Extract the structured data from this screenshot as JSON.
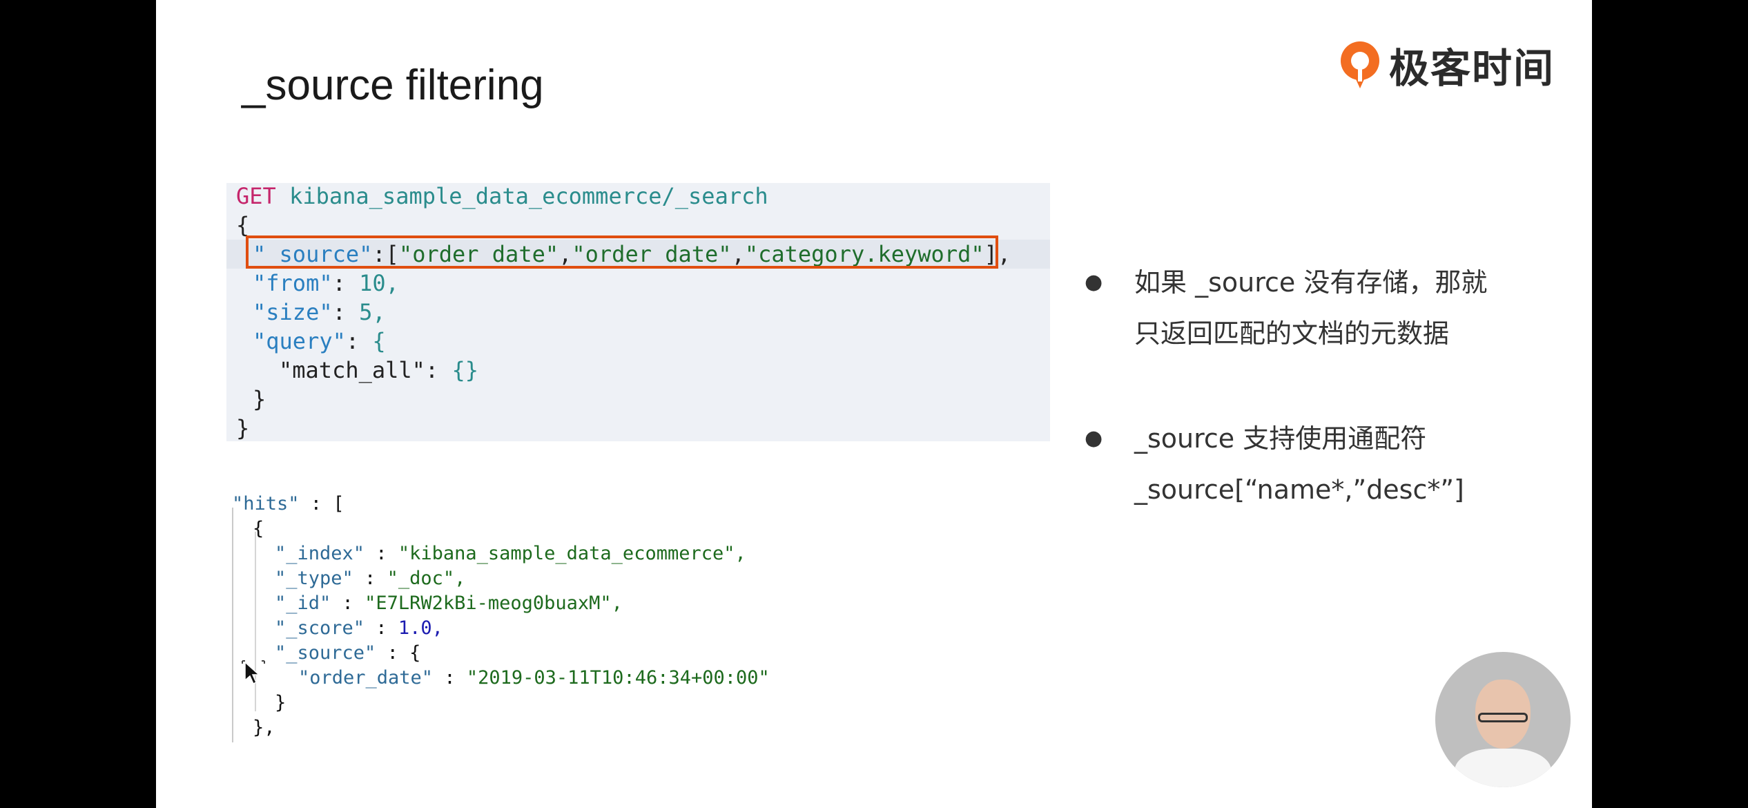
{
  "slide": {
    "title": "_source filtering",
    "logo_text": "极客时间"
  },
  "request_code": {
    "method": "GET",
    "path": "kibana_sample_data_ecommerce/_search",
    "open_brace": "{",
    "source_key": "\"_source\"",
    "source_colon": ":[",
    "source_v1": "\"order_date\"",
    "source_comma1": ",",
    "source_v2": "\"order_date\"",
    "source_comma2": ",",
    "source_v3": "\"category.keyword\"",
    "source_close": "],",
    "from_key": "\"from\"",
    "from_sep": ": ",
    "from_val": "10,",
    "size_key": "\"size\"",
    "size_sep": ": ",
    "size_val": "5,",
    "query_key": "\"query\"",
    "query_sep": ": ",
    "query_open": "{",
    "match_all": "\"match_all\": ",
    "match_all_val": "{}",
    "query_close": "}",
    "close_brace": "}"
  },
  "response_code": {
    "hits_key": "\"hits\"",
    "hits_rest": " : [",
    "obj_open": "{",
    "index_key": "\"_index\"",
    "index_val": "\"kibana_sample_data_ecommerce\",",
    "type_key": "\"_type\"",
    "type_val": "\"_doc\",",
    "id_key": "\"_id\"",
    "id_val": "\"E7LRW2kBi-meog0buaxM\",",
    "score_key": "\"_score\"",
    "score_val": "1.0,",
    "source_key": "\"_source\"",
    "source_open": " : {",
    "order_date_key": "\"order_date\"",
    "order_date_val": "\"2019-03-11T10:46:34+00:00\"",
    "source_close": "}",
    "obj_close": "},",
    "sep": " : "
  },
  "bullets": [
    {
      "marker": "●",
      "line1": "如果 _source 没有存储，那就",
      "line2": "只返回匹配的文档的元数据"
    },
    {
      "marker": "●",
      "line1": "_source 支持使用通配符",
      "line2": "_source[“name*,”desc*”]"
    }
  ],
  "colors": {
    "highlight_border": "#e04e10",
    "logo_orange": "#f36d21",
    "code_bg": "#eef1f6"
  }
}
